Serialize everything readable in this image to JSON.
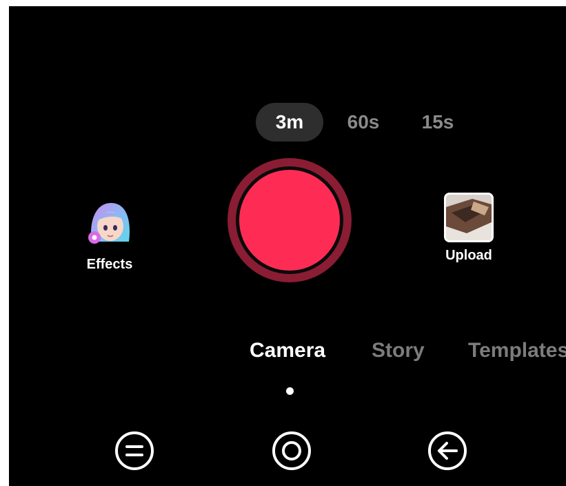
{
  "durations": {
    "options": [
      {
        "label": "3m",
        "selected": true
      },
      {
        "label": "60s",
        "selected": false
      },
      {
        "label": "15s",
        "selected": false
      }
    ]
  },
  "actions": {
    "effects_label": "Effects",
    "upload_label": "Upload"
  },
  "modes": {
    "tabs": [
      {
        "label": "Camera",
        "active": true
      },
      {
        "label": "Story",
        "active": false
      },
      {
        "label": "Templates",
        "active": false
      }
    ]
  },
  "nav": {
    "icons": [
      "menu-icon",
      "home-circle-icon",
      "back-arrow-icon"
    ]
  },
  "colors": {
    "record": "#fe2c55",
    "record_ring": "#8a1d33",
    "background": "#000000",
    "inactive_text": "#7c7c7c"
  }
}
